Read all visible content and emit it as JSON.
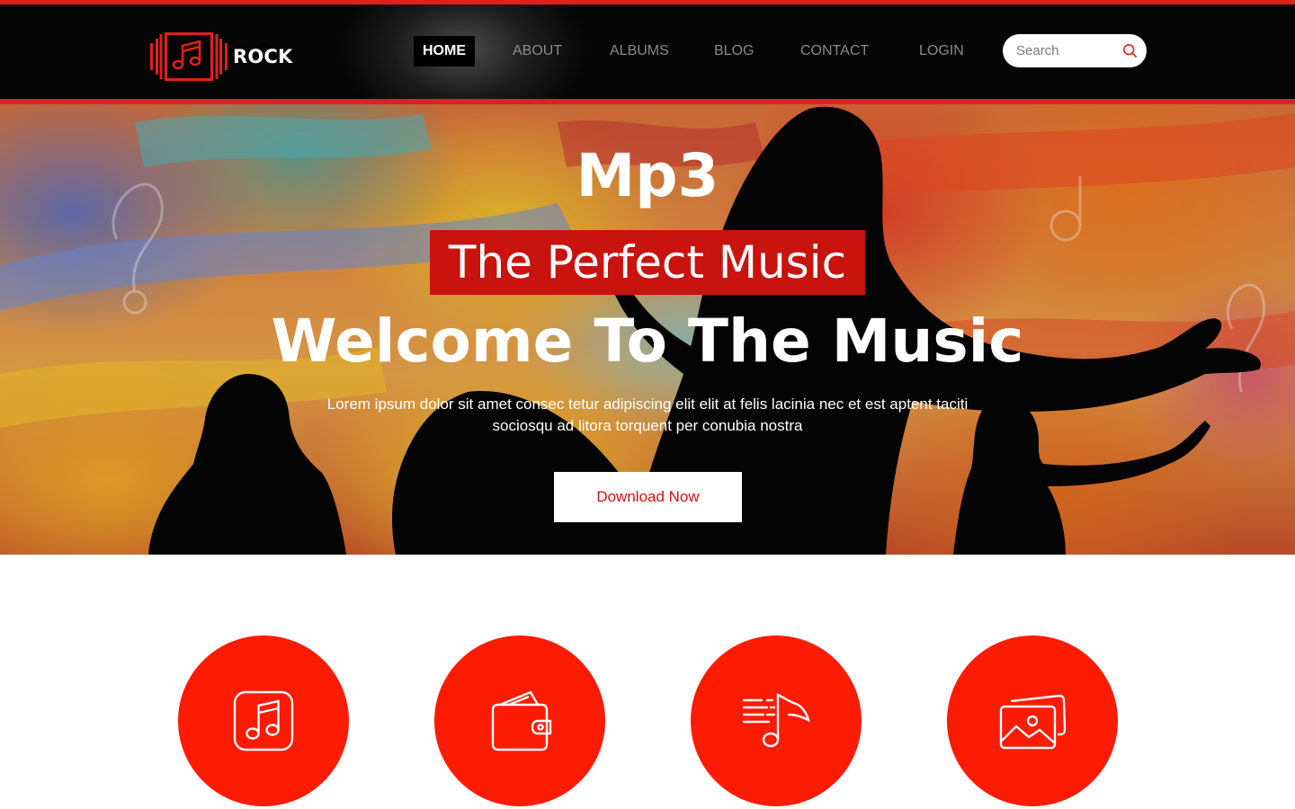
{
  "header": {
    "brand": "ROCK",
    "nav": [
      {
        "label": "HOME",
        "active": true
      },
      {
        "label": "ABOUT",
        "active": false
      },
      {
        "label": "ALBUMS",
        "active": false
      },
      {
        "label": "BLOG",
        "active": false
      },
      {
        "label": "CONTACT",
        "active": false
      },
      {
        "label": "LOGIN",
        "active": false
      }
    ],
    "search": {
      "placeholder": "Search",
      "value": ""
    }
  },
  "hero": {
    "kicker": "Mp3",
    "tagline": "The Perfect Music",
    "title": "Welcome To The Music",
    "description": "Lorem ipsum dolor sit amet consec tetur adipiscing elit elit at felis lacinia nec et est aptent taciti sociosqu ad litora torquent per conubia nostra",
    "cta_label": "Download Now"
  },
  "features": [
    {
      "icon": "music-note-square-icon"
    },
    {
      "icon": "wallet-icon"
    },
    {
      "icon": "playlist-icon"
    },
    {
      "icon": "gallery-icon"
    }
  ],
  "colors": {
    "accent": "#e1201b",
    "feature_circle": "#fd1b04",
    "tagline_bg": "#c8130e",
    "header_bg": "#060606"
  }
}
